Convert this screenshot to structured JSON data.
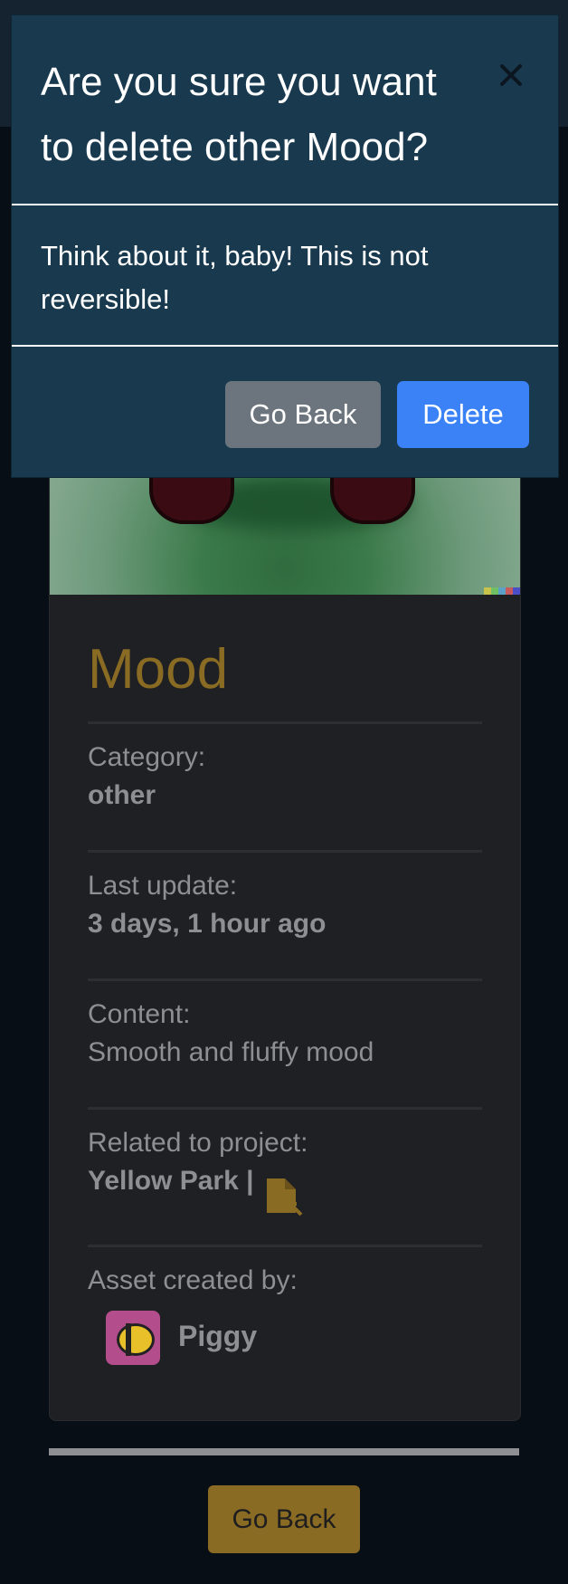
{
  "modal": {
    "title": "Are you sure you want to delete other Mood?",
    "message": "Think about it, baby! This is not reversible!",
    "cancel_label": "Go Back",
    "confirm_label": "Delete",
    "close_icon": "close-icon"
  },
  "asset": {
    "title": "Mood",
    "category_label": "Category:",
    "category_value": "other",
    "last_update_label": "Last update:",
    "last_update_value": "3 days, 1 hour ago",
    "content_label": "Content:",
    "content_value": "Smooth and fluffy mood",
    "project_label": "Related to project:",
    "project_value": "Yellow Park |",
    "project_icon": "file-link-icon",
    "created_by_label": "Asset created by:",
    "creator_name": "Piggy"
  },
  "footer": {
    "back_label": "Go Back"
  },
  "colors": {
    "accent": "#8a6b23",
    "modal_bg": "#193a4e",
    "primary": "#3b82f6",
    "secondary": "#6c757d"
  }
}
